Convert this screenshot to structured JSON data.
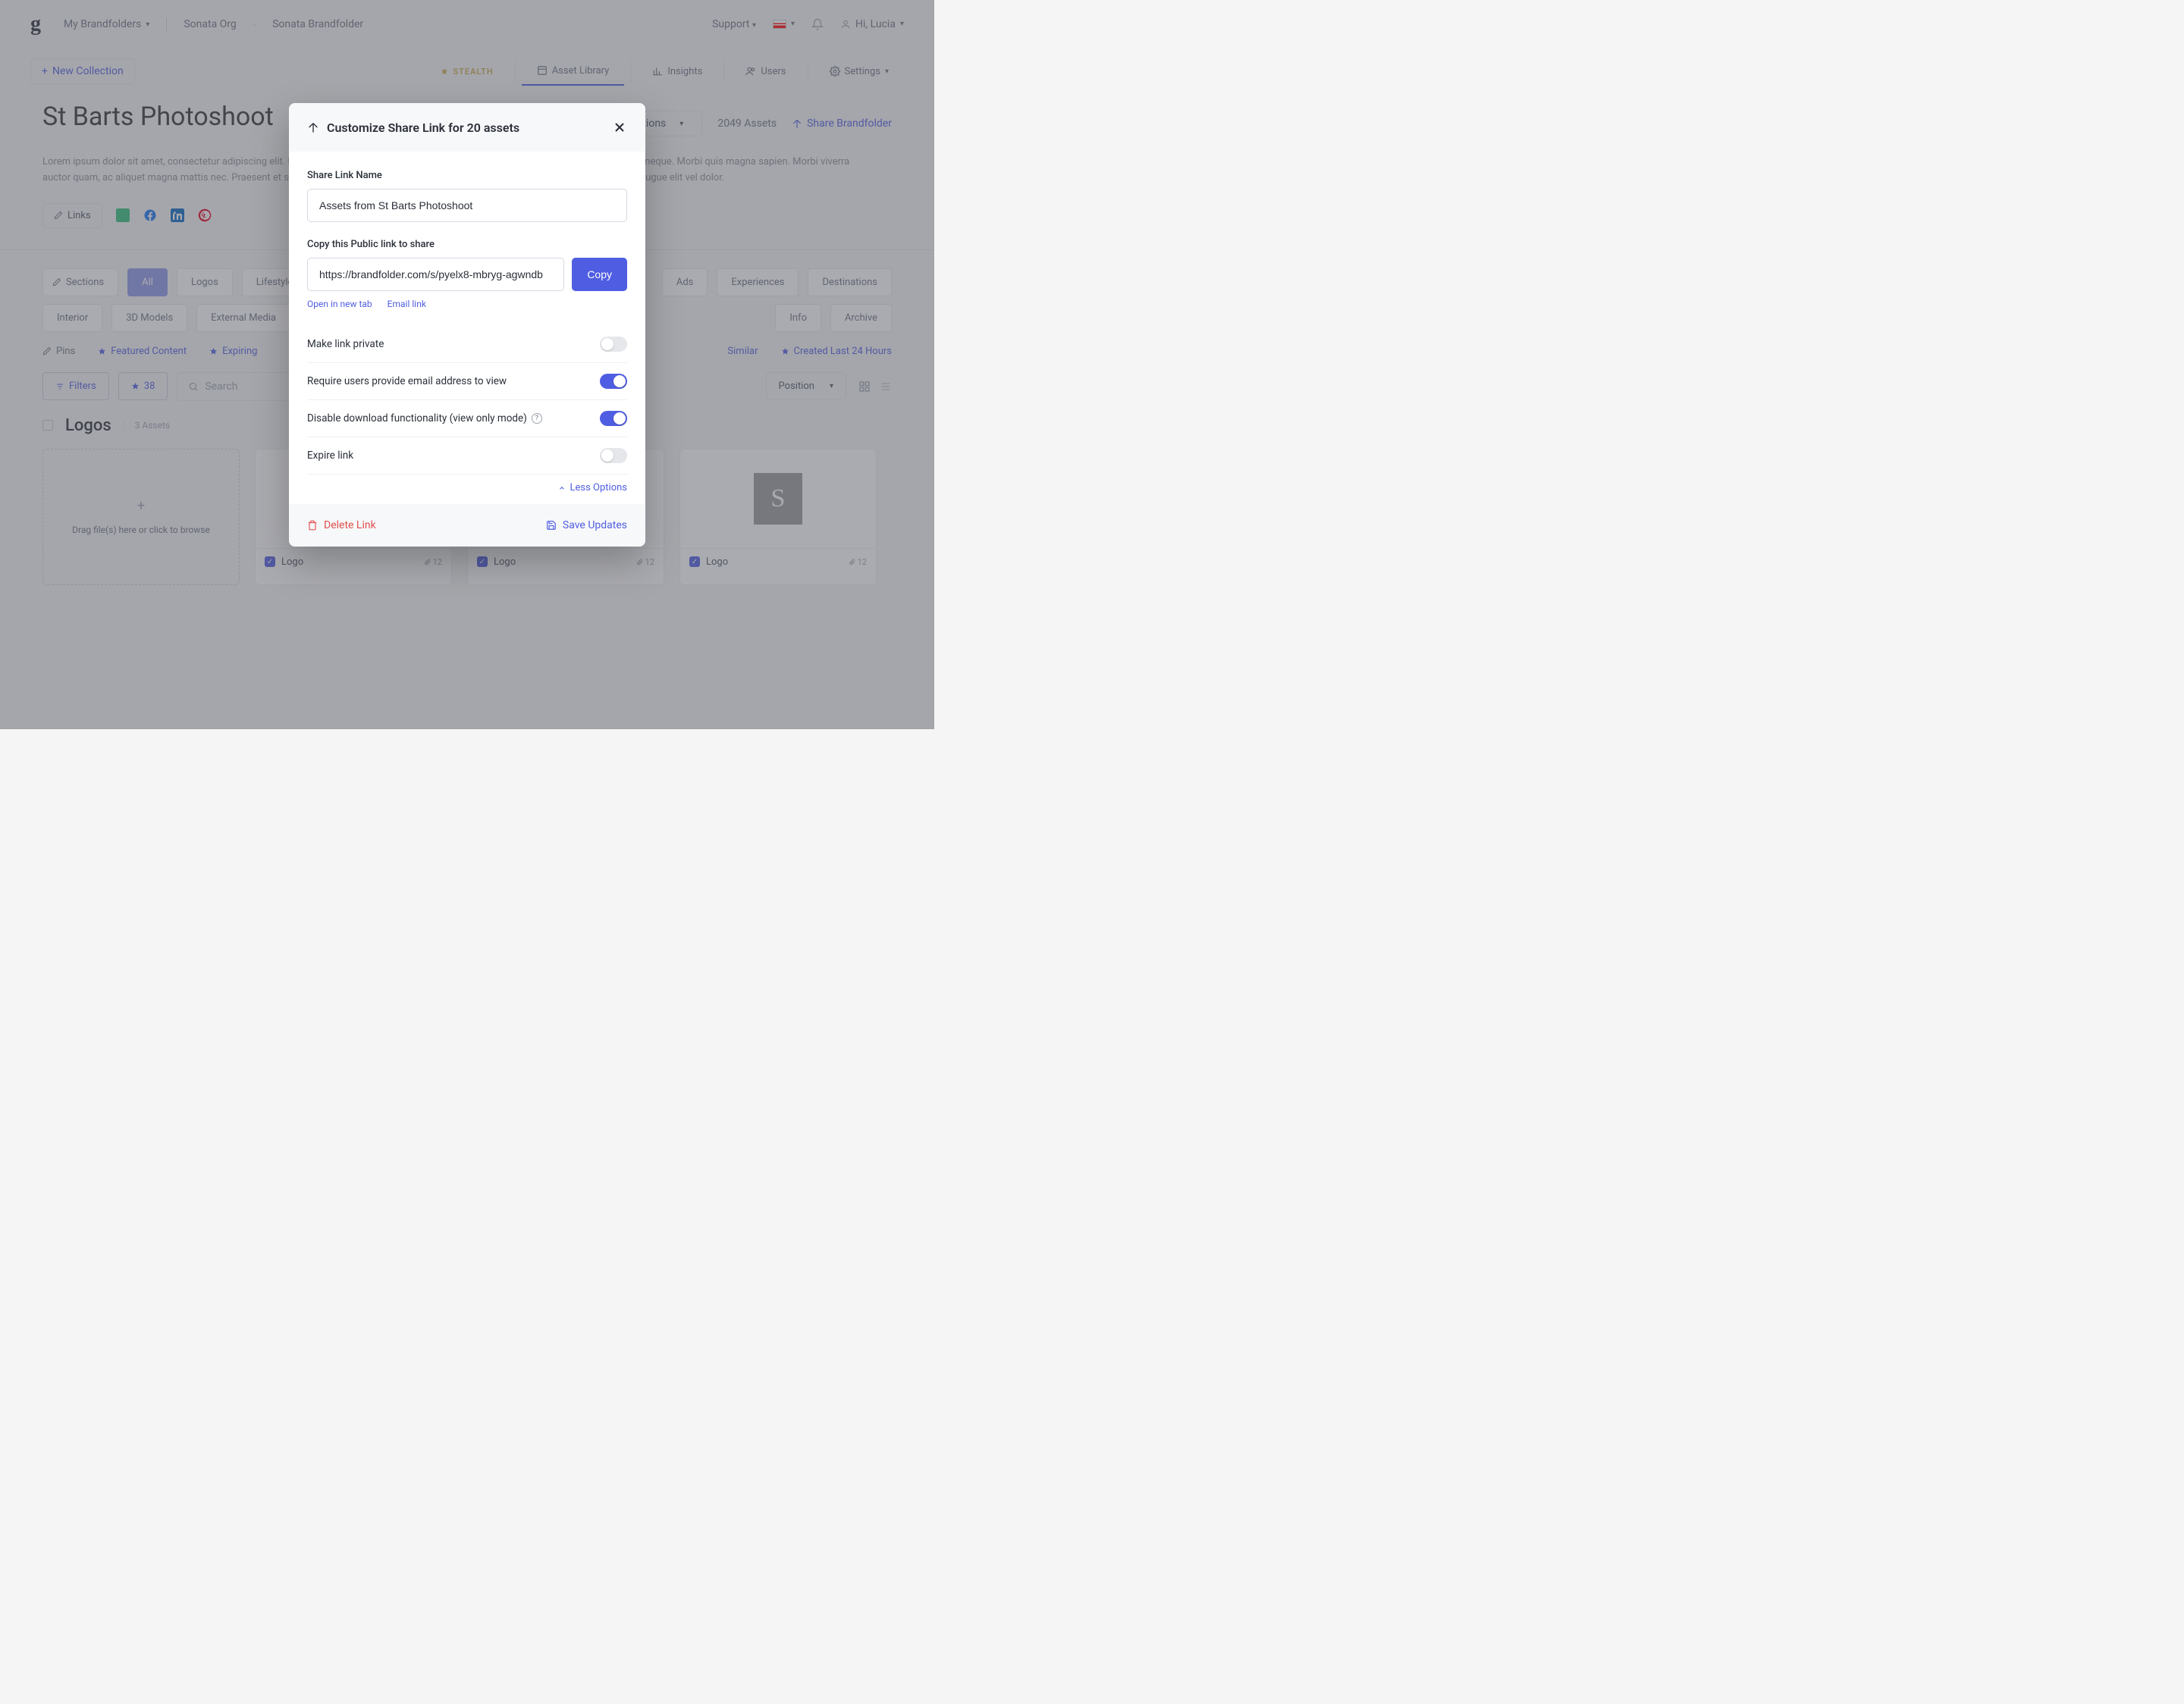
{
  "header": {
    "brandfolders_label": "My Brandfolders",
    "org": "Sonata Org",
    "brandfolder": "Sonata Brandfolder",
    "support_label": "Support",
    "user_greeting": "Hi, Lucia"
  },
  "subnav": {
    "new_collection": "New Collection",
    "stealth": "STEALTH",
    "asset_library": "Asset Library",
    "insights": "Insights",
    "users": "Users",
    "settings": "Settings"
  },
  "page": {
    "title": "St Barts Photoshoot",
    "selection_label": "All selections",
    "asset_total": "2049 Assets",
    "share_brandfolder": "Share Brandfolder",
    "description": "Lorem ipsum dolor sit amet, consectetur adipiscing elit. Proin egestas a odio eget suscipit. Aliquam ac vehicula arcu. Fusce in vestibulum neque. Morbi quis magna sapien. Morbi viverra auctor quam, ac aliquet magna mattis nec. Praesent et sapien vitae mauris egestas auctor. Pellentesque hendrerit lectus diam, ut finibus augue elit vel dolor.",
    "links_label": "Links"
  },
  "filter_chips": {
    "sections": "Sections",
    "all": "All",
    "logos": "Logos",
    "lifestyle": "Lifestyle",
    "ads": "Ads",
    "experiences": "Experiences",
    "destinations": "Destinations",
    "interior": "Interior",
    "models": "3D Models",
    "external_media": "External Media",
    "info": "Info",
    "archive": "Archive"
  },
  "pins": {
    "pins_label": "Pins",
    "featured": "Featured Content",
    "expiring": "Expiring",
    "similar": "Similar",
    "created_24h": "Created Last 24 Hours"
  },
  "toolbar": {
    "filters": "Filters",
    "pinned_count": "38",
    "search_placeholder": "Search",
    "sort_label": "Position"
  },
  "section": {
    "name": "Logos",
    "count": "3 Assets",
    "drop_hint": "Drag file(s) here or click to browse"
  },
  "cards": [
    {
      "label": "Logo",
      "count": "12"
    },
    {
      "label": "Logo",
      "count": "12"
    },
    {
      "label": "Logo",
      "count": "12"
    }
  ],
  "modal": {
    "title": "Customize Share Link for 20 assets",
    "name_label": "Share Link Name",
    "name_value": "Assets from St Barts Photoshoot",
    "link_label": "Copy this Public link to share",
    "link_value": "https://brandfolder.com/s/pyelx8-mbryg-agwndb",
    "copy": "Copy",
    "open_new_tab": "Open in new tab",
    "email_link": "Email link",
    "toggles": {
      "private": "Make link private",
      "require_email": "Require users provide email address to view",
      "disable_download": "Disable download functionality (view only mode)",
      "expire": "Expire link"
    },
    "less_options": "Less Options",
    "delete": "Delete Link",
    "save": "Save Updates"
  }
}
